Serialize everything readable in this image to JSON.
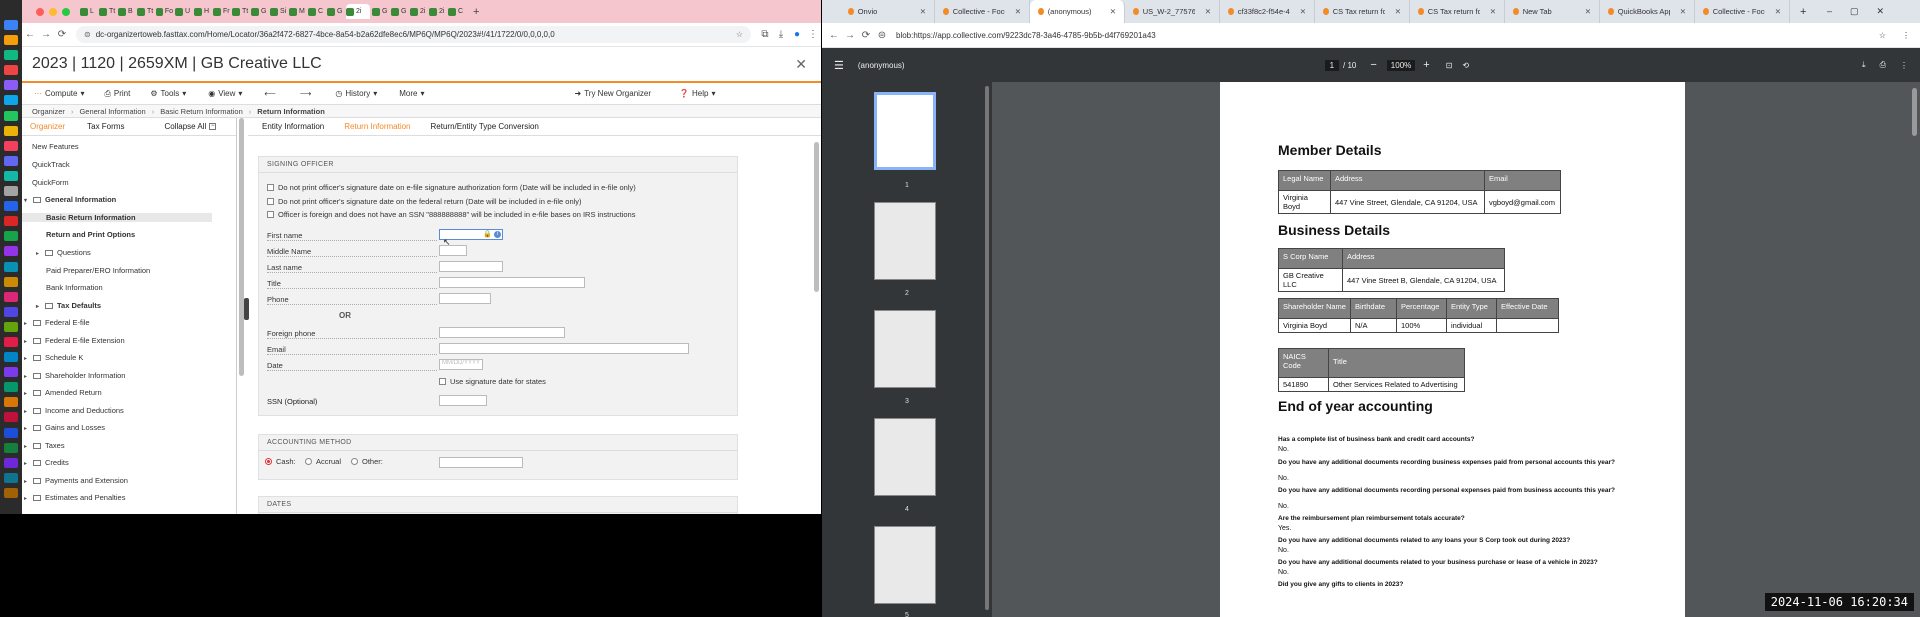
{
  "left_window": {
    "tab_labels": [
      "L",
      "Tt",
      "B",
      "Tt",
      "Fo",
      "U",
      "H",
      "Fr",
      "Tt",
      "G",
      "Si",
      "M",
      "C",
      "G",
      "2i",
      "G",
      "G",
      "2i",
      "2i",
      "C"
    ],
    "url": "dc-organizertoweb.fasttax.com/Home/Locator/36a2f472-6827-4bce-8a54-b2a62dfe8ec6/MP6Q/MP6Q/2023#!/41/1722/0/0,0,0,0,0",
    "app_title": "2023 | 1120 | 2659XM | GB Creative LLC",
    "menu": {
      "compute": "Compute",
      "print": "Print",
      "tools": "Tools",
      "view": "View",
      "history": "History",
      "more": "More",
      "try_new": "Try New Organizer",
      "help": "Help"
    },
    "breadcrumb": [
      "Organizer",
      "General Information",
      "Basic Return Information",
      "Return Information"
    ],
    "sidebar": {
      "tab_organizer": "Organizer",
      "tab_tax_forms": "Tax Forms",
      "collapse_all": "Collapse All",
      "items": [
        "New Features",
        "QuickTrack",
        "QuickForm",
        "General Information",
        "Basic Return Information",
        "Return and Print Options",
        "Questions",
        "Paid Preparer/ERO Information",
        "Bank Information",
        "Tax Defaults",
        "Federal E-file",
        "Federal E-file Extension",
        "Schedule K",
        "Shareholder Information",
        "Amended Return",
        "Income and Deductions",
        "Gains and Losses",
        "Taxes",
        "Credits",
        "Payments and Extension",
        "Estimates and Penalties"
      ]
    },
    "content_tabs": [
      "Entity Information",
      "Return Information",
      "Return/Entity Type Conversion"
    ],
    "signing_officer": {
      "heading": "SIGNING OFFICER",
      "checkboxes": [
        "Do not print officer's signature date on e-file signature authorization form (Date will be included in e-file only)",
        "Do not print officer's signature date on the federal return (Date will be included in e-file only)",
        "Officer is foreign and does not have an SSN \"888888888\" will be included in e-file bases on IRS instructions"
      ],
      "fields": [
        "First name",
        "Middle Name",
        "Last name",
        "Title",
        "Phone"
      ],
      "or_label": "OR",
      "fields2": [
        "Foreign phone",
        "Email",
        "Date"
      ],
      "date_placeholder": "MM/DD/YYYY",
      "use_sig_date": "Use signature date for states",
      "ssn_label": "SSN (Optional)"
    },
    "accounting_method": {
      "heading": "ACCOUNTING METHOD",
      "options": [
        "Cash:",
        "Accrual",
        "Other:"
      ],
      "selected": "Cash:"
    },
    "dates_heading": "DATES"
  },
  "right_window": {
    "tabs": [
      "Onvio",
      "Collective - Focus",
      "(anonymous)",
      "US_W-2_775761",
      "cf33f8c2-f54e-45",
      "CS Tax return for",
      "CS Tax return for",
      "New Tab",
      "QuickBooks App",
      "Collective - Focus"
    ],
    "active_tab": "(anonymous)",
    "url": "blob:https://app.collective.com/9223dc78-3a46-4785-9b5b-d4f769201a43",
    "pdf": {
      "title": "(anonymous)",
      "page_current": "1",
      "page_total": "/ 10",
      "zoom": "100%",
      "thumb_numbers": [
        "1",
        "2",
        "3",
        "4",
        "5"
      ]
    },
    "document": {
      "member_heading": "Member Details",
      "member_table": {
        "headers": [
          "Legal Name",
          "Address",
          "Email"
        ],
        "rows": [
          [
            "Virginia Boyd",
            "447 Vine Street, Glendale, CA 91204, USA",
            "vgboyd@gmail.com"
          ]
        ]
      },
      "business_heading": "Business Details",
      "business_table": {
        "headers": [
          "S Corp Name",
          "Address"
        ],
        "rows": [
          [
            "GB Creative LLC",
            "447 Vine Street B, Glendale, CA 91204, USA"
          ]
        ]
      },
      "shareholder_table": {
        "headers": [
          "Shareholder Name",
          "Birthdate",
          "Percentage",
          "Entity Type",
          "Effective Date"
        ],
        "rows": [
          [
            "Virginia Boyd",
            "N/A",
            "100%",
            "individual",
            ""
          ]
        ]
      },
      "naics_table": {
        "headers": [
          "NAICS Code",
          "Title"
        ],
        "rows": [
          [
            "541890",
            "Other Services Related to Advertising"
          ]
        ]
      },
      "eoy_heading": "End of year accounting",
      "qa": [
        {
          "q": "Has a complete list of business bank and credit card accounts?",
          "a": "No."
        },
        {
          "q": "Do you have any additional documents recording business expenses paid from personal accounts this year?",
          "a": "No."
        },
        {
          "q": "Do you have any additional documents recording personal expenses paid from business accounts this year?",
          "a": "No."
        },
        {
          "q": "Are the reimbursement plan reimbursement totals accurate?",
          "a": "Yes."
        },
        {
          "q": "Do you have any additional documents related to any loans your S Corp took out during 2023?",
          "a": "No."
        },
        {
          "q": "Do you have any additional documents related to your business purchase or lease of a vehicle in 2023?",
          "a": "No."
        },
        {
          "q": "Did you give any gifts to clients in 2023?",
          "a": ""
        }
      ]
    }
  },
  "clock": "2024-11-06  16:20:34",
  "colors": {
    "accent_orange": "#f28c28",
    "left_tabbar": "#f5c6cd",
    "pdf_dark": "#323639"
  }
}
